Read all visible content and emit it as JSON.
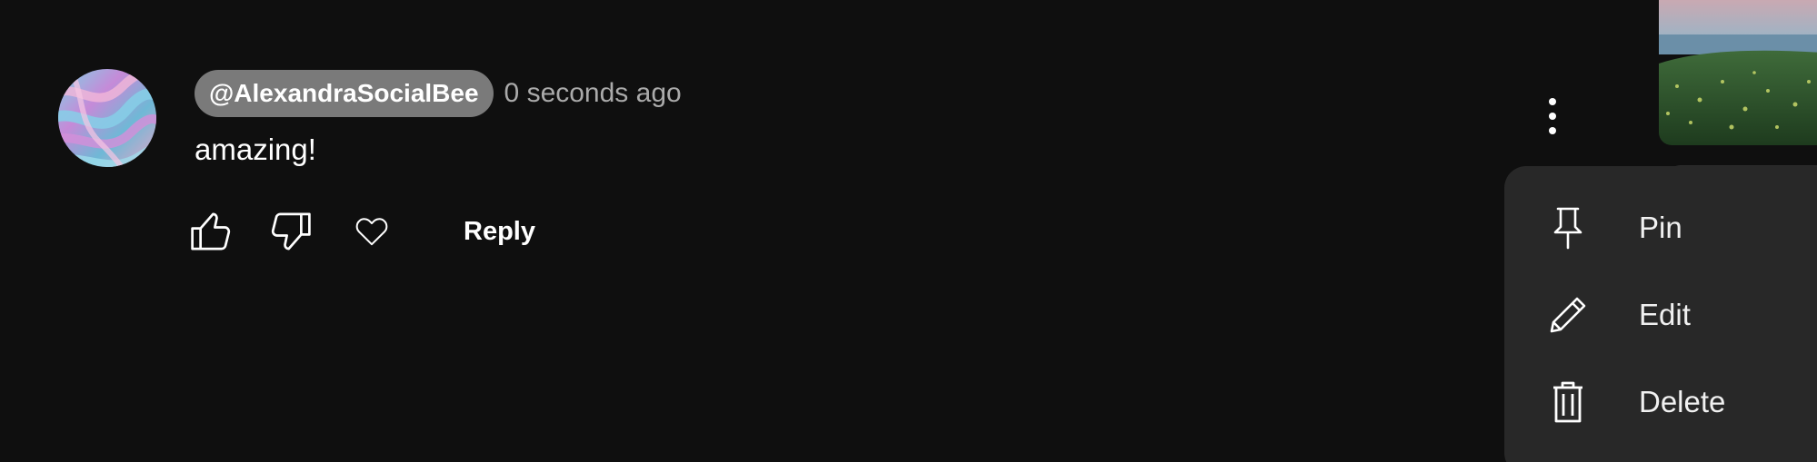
{
  "comment": {
    "author": "@AlexandraSocialBee",
    "timestamp": "0 seconds ago",
    "text": "amazing!",
    "avatar_icon": "marbled-gradient-avatar"
  },
  "actions": {
    "like_icon": "thumb-up-icon",
    "dislike_icon": "thumb-down-icon",
    "heart_icon": "heart-icon",
    "reply_label": "Reply"
  },
  "more_icon": "more-vertical-icon",
  "menu": {
    "items": [
      {
        "label": "Pin",
        "icon": "pin-icon"
      },
      {
        "label": "Edit",
        "icon": "pencil-icon"
      },
      {
        "label": "Delete",
        "icon": "trash-icon"
      }
    ]
  },
  "colors": {
    "background": "#0f0f0f",
    "author_chip": "#7a7a7a",
    "menu_background": "#282828",
    "text_primary": "#ffffff",
    "text_secondary": "#aaaaaa"
  }
}
